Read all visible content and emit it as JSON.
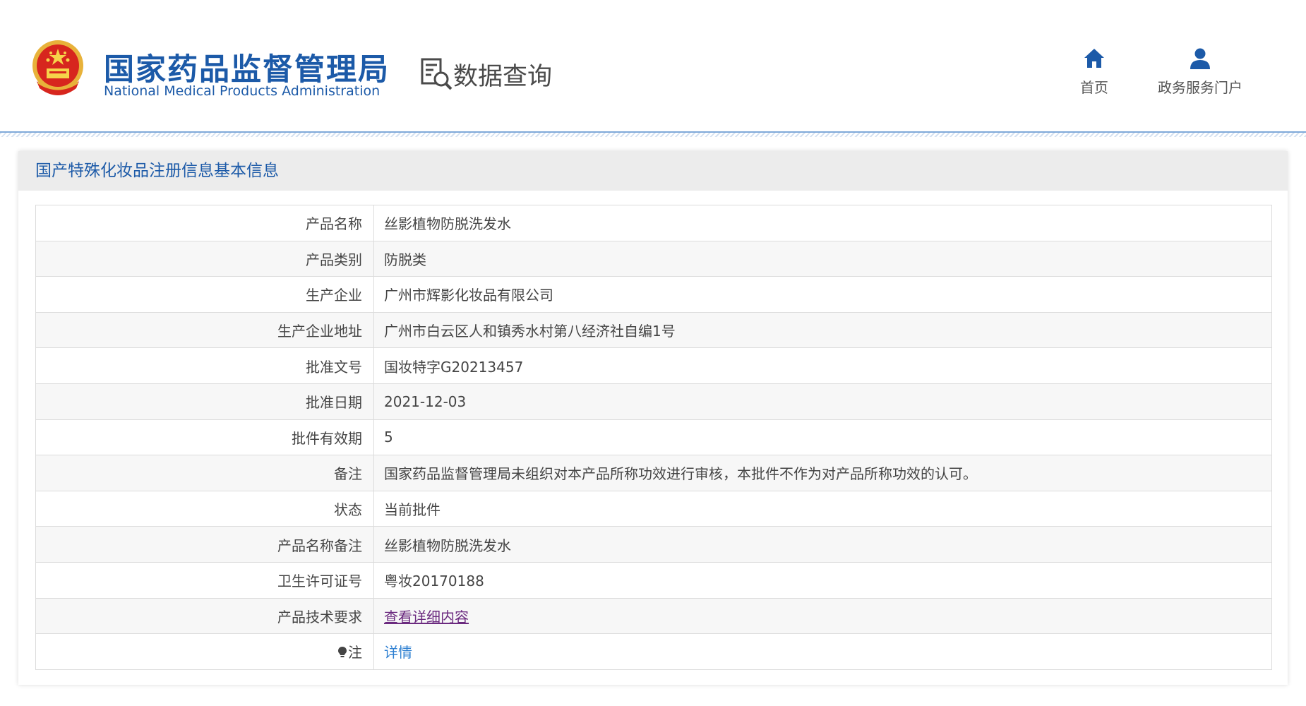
{
  "header": {
    "brand_cn": "国家药品监督管理局",
    "brand_en": "National Medical Products Administration",
    "query_title": "数据查询",
    "nav": [
      {
        "label": "首页",
        "icon": "home-icon"
      },
      {
        "label": "政务服务门户",
        "icon": "user-icon"
      }
    ],
    "accent_color": "#1c5aa8"
  },
  "panel": {
    "title": "国产特殊化妆品注册信息基本信息",
    "rows": [
      {
        "key": "产品名称",
        "value": "丝影植物防脱洗发水"
      },
      {
        "key": "产品类别",
        "value": "防脱类"
      },
      {
        "key": "生产企业",
        "value": "广州市辉影化妆品有限公司"
      },
      {
        "key": "生产企业地址",
        "value": "广州市白云区人和镇秀水村第八经济社自编1号"
      },
      {
        "key": "批准文号",
        "value": "国妆特字G20213457"
      },
      {
        "key": "批准日期",
        "value": "2021-12-03"
      },
      {
        "key": "批件有效期",
        "value": "5"
      },
      {
        "key": "备注",
        "value": "国家药品监督管理局未组织对本产品所称功效进行审核，本批件不作为对产品所称功效的认可。"
      },
      {
        "key": "状态",
        "value": "当前批件"
      },
      {
        "key": "产品名称备注",
        "value": "丝影植物防脱洗发水"
      },
      {
        "key": "卫生许可证号",
        "value": "粤妆20170188"
      }
    ],
    "tech_row": {
      "key": "产品技术要求",
      "link": "查看详细内容"
    },
    "note_row": {
      "key": "注",
      "link": "详情",
      "icon": "lightbulb-icon"
    }
  }
}
